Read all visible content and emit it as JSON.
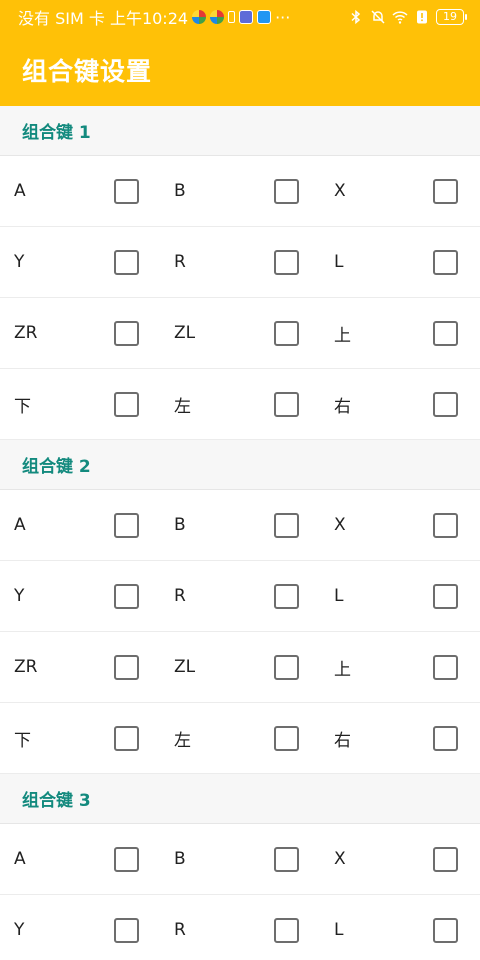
{
  "status_bar": {
    "left_text": "没有 SIM 卡 上午10:24",
    "more": "···",
    "battery": "19"
  },
  "appbar": {
    "title": "组合键设置"
  },
  "groups": [
    {
      "title": "组合键 1",
      "rows": [
        [
          "A",
          "B",
          "X"
        ],
        [
          "Y",
          "R",
          "L"
        ],
        [
          "ZR",
          "ZL",
          "上"
        ],
        [
          "下",
          "左",
          "右"
        ]
      ]
    },
    {
      "title": "组合键 2",
      "rows": [
        [
          "A",
          "B",
          "X"
        ],
        [
          "Y",
          "R",
          "L"
        ],
        [
          "ZR",
          "ZL",
          "上"
        ],
        [
          "下",
          "左",
          "右"
        ]
      ]
    },
    {
      "title": "组合键 3",
      "rows": [
        [
          "A",
          "B",
          "X"
        ],
        [
          "Y",
          "R",
          "L"
        ]
      ]
    }
  ],
  "colors": {
    "app_bar": "#FFC107",
    "group_title": "#138A7E"
  }
}
